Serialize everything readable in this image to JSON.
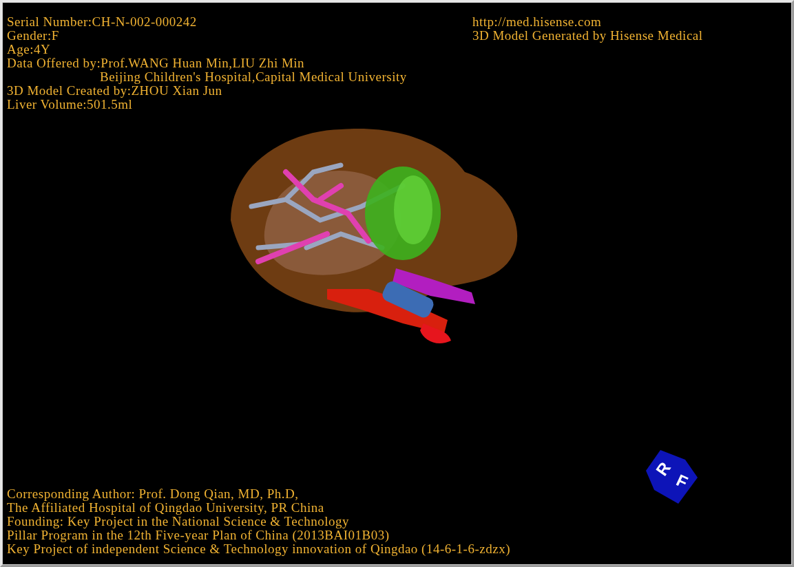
{
  "info_lines": [
    {
      "text": "Serial Number:CH-N-002-000242",
      "indented": false
    },
    {
      "text": "Gender:F",
      "indented": false
    },
    {
      "text": "Age:4Y",
      "indented": false
    },
    {
      "text": "Data Offered by:Prof.WANG Huan Min,LIU Zhi Min",
      "indented": false
    },
    {
      "text": "Beijing Children's Hospital,Capital Medical University",
      "indented": true
    },
    {
      "text": "3D Model Created by:ZHOU Xian Jun",
      "indented": false
    },
    {
      "text": "Liver Volume:501.5ml",
      "indented": false
    }
  ],
  "header_right": [
    "http://med.hisense.com",
    "3D Model Generated by Hisense Medical"
  ],
  "credits": [
    "Corresponding Author: Prof. Dong Qian, MD, Ph.D,",
    "The Affiliated Hospital of Qingdao University, PR China",
    "Founding: Key Project in the National Science & Technology",
    "Pillar Program in the 12th Five-year Plan of China (2013BAI01B03)",
    "Key Project of independent Science & Technology innovation of Qingdao (14-6-1-6-zdzx)"
  ],
  "orientation_cube": {
    "labels": [
      "R",
      "F"
    ]
  }
}
